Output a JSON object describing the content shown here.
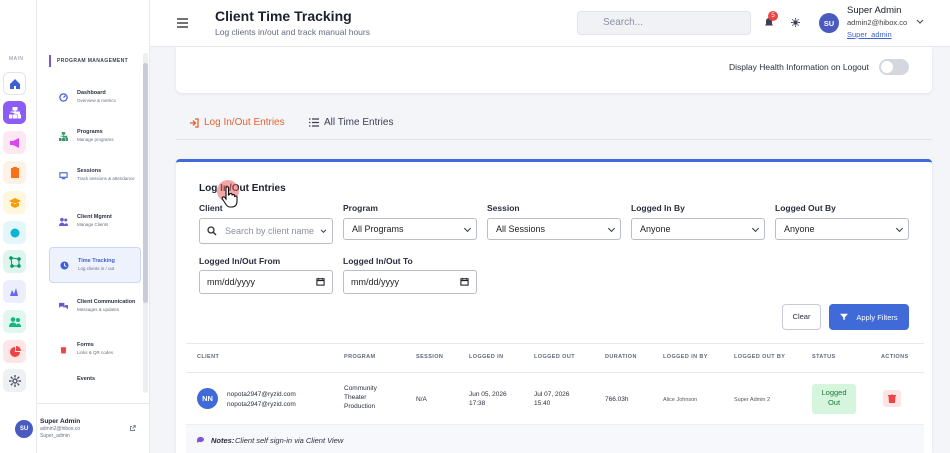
{
  "rail": {
    "label": "MAIN",
    "items": [
      {
        "name": "home-icon",
        "color": "#3f5fd6",
        "bg": "#ffffff"
      },
      {
        "name": "sitemap-icon",
        "color": "#ffffff",
        "bg": "#8b5cf6"
      },
      {
        "name": "megaphone-icon",
        "color": "#d946ef",
        "bg": "#fde7f3"
      },
      {
        "name": "clipboard-icon",
        "color": "#f97316",
        "bg": "#fff1e6"
      },
      {
        "name": "graduation-icon",
        "color": "#f59e0b",
        "bg": "#fff7dd"
      },
      {
        "name": "circle-icon",
        "color": "#06b6d4",
        "bg": "#e3f7fb"
      },
      {
        "name": "network-icon",
        "color": "#059669",
        "bg": "#ddf5ec"
      },
      {
        "name": "signature-icon",
        "color": "#6366f1",
        "bg": "#eceefe"
      },
      {
        "name": "users-icon",
        "color": "#10b981",
        "bg": "#e0f6ee"
      },
      {
        "name": "pie-chart-icon",
        "color": "#ef4444",
        "bg": "#fde6e6"
      },
      {
        "name": "gear-icon",
        "color": "#4b5563",
        "bg": "#eef0f3"
      }
    ]
  },
  "sidebar": {
    "section": "PROGRAM MANAGEMENT",
    "items": [
      {
        "title": "Dashboard",
        "sub": "Overview & metrics",
        "icon": "dashboard-icon",
        "active": false
      },
      {
        "title": "Programs",
        "sub": "Manage programs",
        "icon": "sitemap-icon",
        "active": false
      },
      {
        "title": "Sessions",
        "sub": "Track sessions & attendance",
        "icon": "sessions-icon",
        "active": false
      },
      {
        "title": "Client Mgmnt",
        "sub": "Manage Clients",
        "icon": "users-icon",
        "active": false
      },
      {
        "title": "Time Tracking",
        "sub": "Log clients in / out",
        "icon": "clock-icon",
        "active": true
      },
      {
        "title": "Client Communication",
        "sub": "Messages & updates",
        "icon": "chat-icon",
        "active": false
      },
      {
        "title": "Forms",
        "sub": "Links & QR codes",
        "icon": "trash-icon",
        "active": false
      },
      {
        "title": "Events",
        "sub": "",
        "icon": "",
        "active": false
      }
    ],
    "user": {
      "initials": "SU",
      "name": "Super Admin",
      "email": "admin2@hibox.co",
      "role": "Super_admin"
    }
  },
  "header": {
    "title": "Client Time Tracking",
    "subtitle": "Log clients in/out and track manual hours",
    "search_placeholder": "Search...",
    "notifications": "5",
    "user": {
      "initials": "SU",
      "name": "Super Admin",
      "email": "admin2@hibox.co",
      "role": "Super_admin"
    }
  },
  "health": {
    "label": "Display Health Information on Logout"
  },
  "tabs": [
    {
      "label": "Log In/Out Entries",
      "active": true
    },
    {
      "label": "All Time Entries",
      "active": false
    }
  ],
  "filters": {
    "heading": "Log In/Out Entries",
    "client_label": "Client",
    "client_placeholder": "Search by client name",
    "program_label": "Program",
    "program_value": "All Programs",
    "session_label": "Session",
    "session_value": "All Sessions",
    "logged_in_by_label": "Logged In By",
    "logged_in_by_value": "Anyone",
    "logged_out_by_label": "Logged Out By",
    "logged_out_by_value": "Anyone",
    "from_label": "Logged In/Out From",
    "from_value": "mm/dd/yyyy",
    "to_label": "Logged In/Out To",
    "to_value": "mm/dd/yyyy",
    "clear": "Clear",
    "apply": "Apply Filters"
  },
  "table": {
    "headers": [
      "CLIENT",
      "PROGRAM",
      "SESSION",
      "LOGGED IN",
      "LOGGED OUT",
      "DURATION",
      "LOGGED IN BY",
      "LOGGED OUT BY",
      "STATUS",
      "ACTIONS"
    ],
    "row": {
      "initials": "NN",
      "client_line1": "nopota2947@ryzid.com",
      "client_line2": "nopota2947@ryzid.com",
      "program": "Community Theater Production",
      "session": "N/A",
      "logged_in": "Jun 05, 2026 17:38",
      "logged_out": "Jul 07, 2026 15:40",
      "duration": "766.03h",
      "logged_in_by": "Alice Johnson",
      "logged_out_by": "Super Admin 2",
      "status": "Logged Out"
    },
    "notes_label": "Notes:",
    "notes_text": "Client self sign-in via Client View"
  },
  "colors": {
    "accent": "#3f6ad8",
    "tab_active": "#e8602c",
    "status_bg": "#d6f5dd",
    "status_text": "#1e7a3a",
    "danger": "#ef4444"
  }
}
